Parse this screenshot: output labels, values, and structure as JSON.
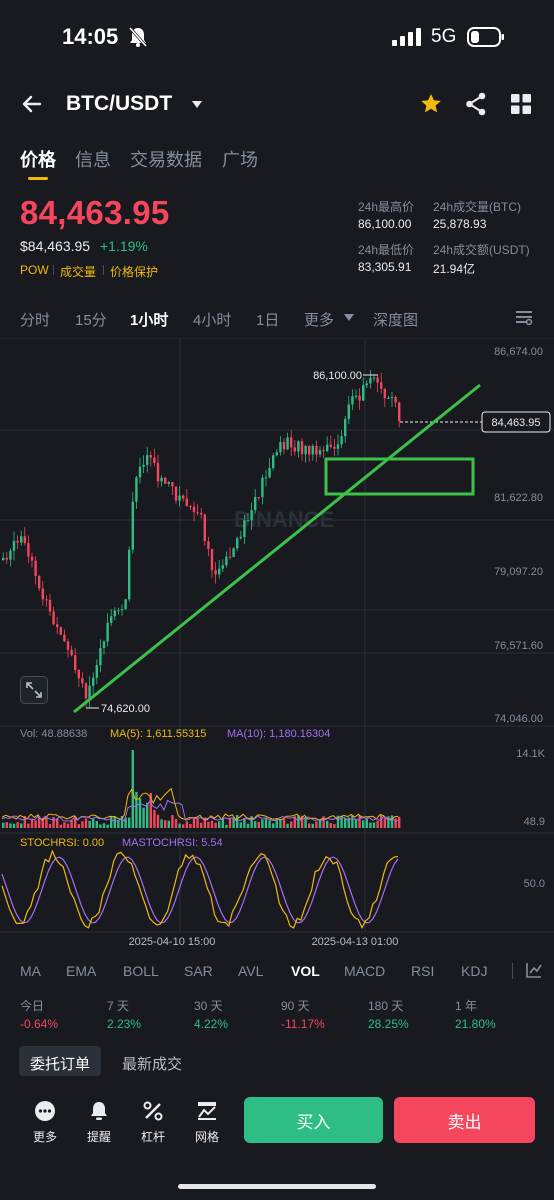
{
  "status_bar": {
    "time": "14:05",
    "network": "5G"
  },
  "header": {
    "pair": "BTC/USDT"
  },
  "tabs": [
    "价格",
    "信息",
    "交易数据",
    "广场"
  ],
  "ticker": {
    "last_price": "84,463.95",
    "usd_price": "$84,463.95",
    "change_pct": "+1.19%",
    "tags": [
      "POW",
      "成交量",
      "价格保护"
    ],
    "stats": {
      "high_label": "24h最高价",
      "high_value": "86,100.00",
      "vol_btc_label": "24h成交量(BTC)",
      "vol_btc_value": "25,878.93",
      "low_label": "24h最低价",
      "low_value": "83,305.91",
      "vol_usdt_label": "24h成交额(USDT)",
      "vol_usdt_value": "21.94亿"
    }
  },
  "intervals": [
    "分时",
    "15分",
    "1小时",
    "4小时",
    "1日",
    "更多",
    "深度图"
  ],
  "chart": {
    "price_axis": [
      "86,674.00",
      "84,463.95",
      "81,622.80",
      "79,097.20",
      "76,571.60",
      "74,046.00"
    ],
    "high_label": "86,100.00",
    "low_label": "74,620.00",
    "watermark": "BINANCE",
    "vol_legend": {
      "vol": "Vol: 48.88638",
      "ma5": "MA(5): 1,611.55315",
      "ma10": "MA(10): 1,180.16304"
    },
    "vol_axis": [
      "14.1K",
      "48.9"
    ],
    "stoch_legend": {
      "stoch": "STOCHRSI: 0.00",
      "mastoch": "MASTOCHRSI: 5.54"
    },
    "stoch_axis": "50.0",
    "time_axis": [
      "2025-04-10 15:00",
      "2025-04-13 01:00"
    ],
    "colors": {
      "up": "#2ebd85",
      "down": "#f6465d",
      "ma5": "#f0b90b",
      "ma10": "#a56ff0",
      "drawing": "#3cc24b"
    }
  },
  "indicators": [
    "MA",
    "EMA",
    "BOLL",
    "SAR",
    "AVL",
    "VOL",
    "MACD",
    "RSI",
    "KDJ"
  ],
  "performance": [
    {
      "label": "今日",
      "value": "-0.64%"
    },
    {
      "label": "7 天",
      "value": "2.23%"
    },
    {
      "label": "30 天",
      "value": "4.22%"
    },
    {
      "label": "90 天",
      "value": "-11.17%"
    },
    {
      "label": "180 天",
      "value": "28.25%"
    },
    {
      "label": "1 年",
      "value": "21.80%"
    }
  ],
  "order_tabs": {
    "orders": "委托订单",
    "recent": "最新成交"
  },
  "actions": [
    {
      "label": "更多",
      "icon": "more-dots-icon"
    },
    {
      "label": "提醒",
      "icon": "bell-icon"
    },
    {
      "label": "杠杆",
      "icon": "leverage-icon"
    },
    {
      "label": "网格",
      "icon": "grid-bot-icon"
    }
  ],
  "buy_label": "买入",
  "sell_label": "卖出"
}
